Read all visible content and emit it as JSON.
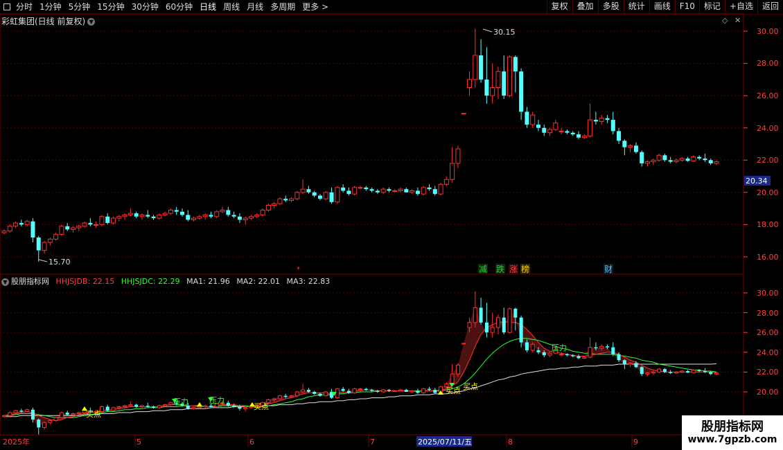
{
  "toolbar": {
    "left_items": [
      "分时",
      "1分钟",
      "5分钟",
      "15分钟",
      "30分钟",
      "60分钟",
      "日线",
      "周线",
      "月线",
      "多周期",
      "更多 >"
    ],
    "right_items": [
      "复权",
      "叠加",
      "多股",
      "统计",
      "画线",
      "F10",
      "标记",
      "+自选",
      "返回"
    ],
    "menu_icon": "menu-box-icon"
  },
  "stock": {
    "title": "彩虹集团(日线 前复权)",
    "current_price_label": "20.34",
    "high_label": "30.15",
    "low_label": "15.70"
  },
  "main_axis": {
    "labels": [
      "30.00",
      "28.00",
      "26.00",
      "24.00",
      "22.00",
      "20.00",
      "18.00",
      "16.00"
    ]
  },
  "indicator_axis": {
    "labels": [
      "30.00",
      "28.00",
      "26.00",
      "24.00",
      "22.00",
      "20.00"
    ]
  },
  "events": [
    {
      "text": "减",
      "color": "#2ecc40"
    },
    {
      "text": "跌",
      "color": "#2ecc40"
    },
    {
      "text": "涨",
      "color": "#ff4040"
    },
    {
      "text": "榜",
      "color": "#ffcc00"
    },
    {
      "text": "财",
      "color": "#4fc3f7"
    }
  ],
  "indicator": {
    "name": "股朋指标网",
    "hhjsjdb": "HHJSJDB: 22.15",
    "hhjsjdc": "HHJSJDC: 22.29",
    "ma1": "MA1: 21.96",
    "ma2": "MA2: 22.01",
    "ma3": "MA3: 22.83",
    "signals": {
      "pressure": "压力",
      "buy": "买点"
    }
  },
  "date_axis": {
    "labels": [
      "2025年",
      "5",
      "6",
      "7",
      "8",
      "9"
    ],
    "cursor": "2025/07/11/五"
  },
  "watermark": {
    "title": "股朋指标网",
    "url": "www.7gpzb.com"
  },
  "colors": {
    "up": "#ff3030",
    "down": "#54ffff",
    "grid": "#5a0000",
    "hhjsjdb": "#ff3030",
    "hhjsjdc": "#30ff30",
    "ma_white": "#e0e0e0"
  },
  "chart_data": {
    "type": "candlestick",
    "ylim": [
      15.0,
      31.0
    ],
    "ohlc": [
      [
        17.5,
        17.7,
        17.4,
        17.6
      ],
      [
        17.6,
        18.0,
        17.5,
        17.9
      ],
      [
        17.9,
        18.2,
        17.8,
        18.1
      ],
      [
        18.1,
        18.3,
        17.9,
        18.0
      ],
      [
        18.0,
        18.3,
        17.9,
        18.2
      ],
      [
        18.2,
        18.4,
        16.9,
        17.2
      ],
      [
        17.2,
        17.3,
        15.7,
        16.4
      ],
      [
        16.4,
        17.0,
        16.2,
        16.9
      ],
      [
        16.9,
        17.2,
        16.7,
        17.1
      ],
      [
        17.1,
        17.5,
        17.0,
        17.4
      ],
      [
        17.4,
        18.0,
        17.3,
        17.9
      ],
      [
        17.9,
        18.1,
        17.6,
        17.7
      ],
      [
        17.7,
        17.9,
        17.5,
        17.8
      ],
      [
        17.8,
        18.0,
        17.6,
        17.9
      ],
      [
        17.9,
        18.2,
        17.8,
        18.1
      ],
      [
        18.1,
        18.4,
        17.9,
        18.0
      ],
      [
        18.0,
        18.2,
        17.8,
        18.0
      ],
      [
        18.0,
        18.6,
        17.9,
        18.5
      ],
      [
        18.5,
        18.7,
        18.0,
        18.1
      ],
      [
        18.1,
        18.5,
        18.0,
        18.4
      ],
      [
        18.4,
        18.6,
        18.2,
        18.5
      ],
      [
        18.5,
        18.7,
        18.3,
        18.6
      ],
      [
        18.6,
        19.0,
        18.5,
        18.7
      ],
      [
        18.7,
        18.8,
        18.4,
        18.5
      ],
      [
        18.5,
        18.7,
        18.3,
        18.6
      ],
      [
        18.6,
        18.9,
        18.4,
        18.5
      ],
      [
        18.5,
        18.6,
        18.3,
        18.4
      ],
      [
        18.4,
        18.7,
        18.3,
        18.6
      ],
      [
        18.6,
        18.8,
        18.5,
        18.7
      ],
      [
        18.7,
        19.0,
        18.6,
        18.9
      ],
      [
        18.9,
        19.1,
        18.6,
        18.8
      ],
      [
        18.8,
        19.0,
        18.5,
        18.6
      ],
      [
        18.6,
        18.9,
        18.2,
        18.3
      ],
      [
        18.3,
        18.5,
        18.2,
        18.4
      ],
      [
        18.4,
        18.6,
        18.3,
        18.5
      ],
      [
        18.5,
        18.7,
        18.3,
        18.6
      ],
      [
        18.6,
        18.8,
        18.4,
        18.5
      ],
      [
        18.5,
        18.9,
        18.4,
        18.8
      ],
      [
        18.8,
        19.1,
        18.7,
        18.9
      ],
      [
        18.9,
        19.1,
        18.5,
        18.6
      ],
      [
        18.6,
        18.8,
        18.4,
        18.5
      ],
      [
        18.5,
        18.7,
        18.1,
        18.3
      ],
      [
        18.3,
        18.5,
        18.0,
        18.4
      ],
      [
        18.4,
        18.6,
        18.3,
        18.5
      ],
      [
        18.5,
        18.7,
        18.4,
        18.6
      ],
      [
        18.6,
        19.0,
        18.5,
        18.9
      ],
      [
        18.9,
        19.3,
        18.8,
        19.2
      ],
      [
        19.2,
        19.4,
        19.0,
        19.3
      ],
      [
        19.3,
        19.7,
        19.2,
        19.6
      ],
      [
        19.6,
        19.8,
        19.4,
        19.5
      ],
      [
        19.5,
        19.7,
        19.4,
        19.6
      ],
      [
        19.6,
        20.1,
        19.5,
        20.0
      ],
      [
        20.0,
        20.8,
        19.9,
        20.2
      ],
      [
        20.2,
        20.4,
        19.9,
        20.0
      ],
      [
        20.0,
        20.1,
        19.7,
        19.8
      ],
      [
        19.8,
        19.9,
        19.5,
        19.6
      ],
      [
        19.6,
        20.1,
        19.5,
        20.0
      ],
      [
        20.0,
        20.3,
        19.3,
        19.4
      ],
      [
        19.4,
        20.4,
        19.3,
        20.3
      ],
      [
        20.3,
        20.5,
        20.0,
        20.1
      ],
      [
        20.1,
        20.3,
        19.8,
        19.9
      ],
      [
        19.9,
        20.4,
        19.8,
        20.3
      ],
      [
        20.3,
        20.4,
        20.2,
        20.3
      ],
      [
        20.3,
        20.4,
        20.1,
        20.2
      ],
      [
        20.2,
        20.3,
        20.0,
        20.1
      ],
      [
        20.1,
        20.2,
        19.9,
        20.0
      ],
      [
        20.0,
        20.3,
        19.9,
        20.2
      ],
      [
        20.2,
        20.3,
        20.0,
        20.1
      ],
      [
        20.1,
        20.2,
        20.0,
        20.1
      ],
      [
        20.1,
        20.3,
        20.0,
        20.2
      ],
      [
        20.2,
        20.3,
        20.0,
        20.0
      ],
      [
        20.0,
        20.2,
        19.9,
        20.1
      ],
      [
        20.1,
        20.3,
        19.8,
        19.9
      ],
      [
        19.9,
        20.4,
        19.8,
        20.3
      ],
      [
        20.3,
        20.5,
        20.1,
        20.2
      ],
      [
        20.2,
        20.4,
        19.8,
        19.9
      ],
      [
        19.9,
        20.6,
        19.8,
        20.5
      ],
      [
        20.5,
        21.0,
        20.4,
        20.8
      ],
      [
        20.8,
        22.8,
        20.6,
        21.8
      ],
      [
        21.8,
        22.9,
        21.5,
        22.7
      ],
      [
        24.9,
        24.9,
        24.9,
        24.9
      ],
      [
        26.5,
        27.5,
        26.0,
        27.0
      ],
      [
        27.0,
        30.15,
        26.5,
        28.5
      ],
      [
        28.5,
        29.5,
        26.8,
        27.0
      ],
      [
        27.0,
        29.0,
        25.5,
        26.0
      ],
      [
        26.0,
        28.0,
        25.5,
        26.5
      ],
      [
        26.5,
        27.8,
        25.8,
        27.5
      ],
      [
        27.5,
        28.5,
        25.8,
        26.0
      ],
      [
        26.0,
        28.5,
        25.9,
        28.4
      ],
      [
        28.4,
        28.5,
        26.2,
        27.5
      ],
      [
        27.5,
        27.7,
        24.5,
        25.0
      ],
      [
        25.0,
        25.3,
        24.0,
        24.2
      ],
      [
        24.2,
        25.0,
        24.0,
        24.8
      ],
      [
        24.2,
        24.5,
        23.8,
        24.0
      ],
      [
        24.0,
        24.2,
        23.5,
        23.7
      ],
      [
        23.7,
        24.0,
        23.5,
        23.9
      ],
      [
        23.9,
        24.5,
        23.8,
        24.3
      ],
      [
        23.8,
        24.0,
        23.6,
        23.8
      ],
      [
        23.8,
        23.9,
        23.6,
        23.7
      ],
      [
        23.7,
        23.8,
        23.5,
        23.6
      ],
      [
        23.6,
        23.8,
        23.3,
        23.4
      ],
      [
        23.4,
        23.6,
        23.3,
        23.5
      ],
      [
        23.5,
        25.5,
        23.4,
        24.5
      ],
      [
        24.5,
        25.0,
        24.2,
        24.4
      ],
      [
        24.4,
        24.8,
        24.2,
        24.6
      ],
      [
        24.6,
        24.8,
        24.3,
        24.5
      ],
      [
        24.5,
        25.0,
        23.6,
        23.8
      ],
      [
        23.8,
        24.0,
        23.0,
        23.2
      ],
      [
        23.2,
        23.3,
        22.3,
        22.8
      ],
      [
        22.8,
        23.0,
        22.5,
        22.9
      ],
      [
        22.9,
        23.1,
        22.4,
        22.5
      ],
      [
        22.5,
        22.6,
        21.6,
        21.8
      ],
      [
        21.8,
        22.0,
        21.6,
        21.9
      ],
      [
        21.9,
        22.1,
        21.7,
        22.0
      ],
      [
        22.0,
        22.4,
        21.9,
        22.3
      ],
      [
        22.3,
        22.4,
        21.9,
        22.0
      ],
      [
        22.0,
        22.2,
        21.8,
        21.9
      ],
      [
        21.9,
        22.1,
        21.8,
        22.0
      ],
      [
        22.0,
        22.2,
        21.9,
        22.1
      ],
      [
        22.1,
        22.2,
        21.9,
        21.95
      ],
      [
        21.95,
        22.3,
        21.9,
        22.2
      ],
      [
        22.2,
        22.3,
        22.0,
        22.1
      ],
      [
        22.1,
        22.4,
        21.9,
        22.0
      ],
      [
        22.0,
        22.1,
        21.7,
        21.8
      ],
      [
        21.8,
        22.0,
        21.7,
        21.9
      ]
    ],
    "ma1": [
      17.6,
      17.7,
      17.8,
      17.9,
      18.0,
      17.9,
      17.6,
      17.4,
      17.2,
      17.1,
      17.2,
      17.4,
      17.5,
      17.7,
      17.8,
      17.9,
      18.0,
      18.1,
      18.1,
      18.2,
      18.3,
      18.4,
      18.5,
      18.5,
      18.5,
      18.5,
      18.5,
      18.5,
      18.6,
      18.7,
      18.7,
      18.7,
      18.6,
      18.6,
      18.5,
      18.5,
      18.5,
      18.6,
      18.7,
      18.7,
      18.7,
      18.6,
      18.5,
      18.5,
      18.5,
      18.6,
      18.8,
      18.9,
      19.1,
      19.3,
      19.4,
      19.6,
      19.8,
      19.9,
      19.9,
      19.9,
      19.9,
      19.8,
      19.9,
      19.9,
      20.0,
      20.1,
      20.1,
      20.2,
      20.2,
      20.1,
      20.1,
      20.1,
      20.1,
      20.1,
      20.1,
      20.1,
      20.0,
      20.1,
      20.1,
      20.1,
      20.2,
      20.3,
      20.6,
      21.0,
      22.0,
      23.2,
      24.6,
      25.8,
      26.5,
      26.8,
      27.0,
      27.1,
      27.0,
      27.0,
      26.8,
      26.3,
      25.7,
      25.0,
      24.4,
      24.1,
      24.0,
      23.9,
      23.8,
      23.7,
      23.6,
      23.6,
      23.7,
      23.8,
      23.9,
      24.0,
      24.0,
      23.8,
      23.5,
      23.2,
      23.0,
      22.7,
      22.4,
      22.2,
      22.1,
      22.0,
      22.0,
      22.0,
      22.0,
      22.0,
      22.0,
      22.0,
      22.0,
      22.0,
      21.96
    ],
    "ma2": [
      17.6,
      17.6,
      17.7,
      17.8,
      17.8,
      17.8,
      17.7,
      17.6,
      17.5,
      17.4,
      17.4,
      17.4,
      17.4,
      17.5,
      17.6,
      17.7,
      17.8,
      17.9,
      18.0,
      18.0,
      18.1,
      18.2,
      18.2,
      18.3,
      18.3,
      18.4,
      18.4,
      18.4,
      18.5,
      18.5,
      18.5,
      18.6,
      18.6,
      18.6,
      18.6,
      18.5,
      18.5,
      18.5,
      18.6,
      18.6,
      18.6,
      18.6,
      18.6,
      18.5,
      18.5,
      18.5,
      18.6,
      18.7,
      18.8,
      18.9,
      19.0,
      19.2,
      19.3,
      19.5,
      19.6,
      19.7,
      19.7,
      19.7,
      19.8,
      19.8,
      19.9,
      19.9,
      20.0,
      20.0,
      20.0,
      20.1,
      20.1,
      20.1,
      20.1,
      20.1,
      20.1,
      20.1,
      20.1,
      20.1,
      20.1,
      20.1,
      20.1,
      20.2,
      20.3,
      20.5,
      20.8,
      21.3,
      21.9,
      22.6,
      23.3,
      23.9,
      24.4,
      24.8,
      25.1,
      25.3,
      25.4,
      25.4,
      25.3,
      25.2,
      25.0,
      24.8,
      24.6,
      24.4,
      24.3,
      24.1,
      24.0,
      23.9,
      23.9,
      23.8,
      23.8,
      23.8,
      23.8,
      23.7,
      23.6,
      23.5,
      23.4,
      23.2,
      23.1,
      23.0,
      22.8,
      22.7,
      22.6,
      22.5,
      22.4,
      22.3,
      22.2,
      22.2,
      22.1,
      22.1,
      22.01
    ],
    "ma3": [
      17.5,
      17.5,
      17.5,
      17.6,
      17.6,
      17.6,
      17.6,
      17.6,
      17.6,
      17.6,
      17.6,
      17.6,
      17.6,
      17.6,
      17.7,
      17.7,
      17.7,
      17.8,
      17.8,
      17.8,
      17.9,
      17.9,
      17.9,
      18.0,
      18.0,
      18.0,
      18.1,
      18.1,
      18.1,
      18.2,
      18.2,
      18.2,
      18.3,
      18.3,
      18.3,
      18.3,
      18.4,
      18.4,
      18.4,
      18.4,
      18.5,
      18.5,
      18.5,
      18.5,
      18.5,
      18.6,
      18.6,
      18.6,
      18.7,
      18.7,
      18.7,
      18.8,
      18.8,
      18.9,
      18.9,
      19.0,
      19.0,
      19.0,
      19.1,
      19.1,
      19.2,
      19.2,
      19.3,
      19.3,
      19.4,
      19.4,
      19.4,
      19.5,
      19.5,
      19.6,
      19.6,
      19.6,
      19.7,
      19.7,
      19.7,
      19.8,
      19.8,
      19.8,
      19.9,
      20.0,
      20.1,
      20.3,
      20.4,
      20.6,
      20.8,
      21.0,
      21.2,
      21.3,
      21.5,
      21.6,
      21.8,
      21.9,
      22.0,
      22.1,
      22.2,
      22.3,
      22.3,
      22.4,
      22.4,
      22.5,
      22.5,
      22.6,
      22.6,
      22.6,
      22.7,
      22.7,
      22.7,
      22.8,
      22.8,
      22.8,
      22.8,
      22.8,
      22.8,
      22.8,
      22.8,
      22.8,
      22.8,
      22.8,
      22.8,
      22.8,
      22.8,
      22.8,
      22.8,
      22.8,
      22.83
    ]
  }
}
